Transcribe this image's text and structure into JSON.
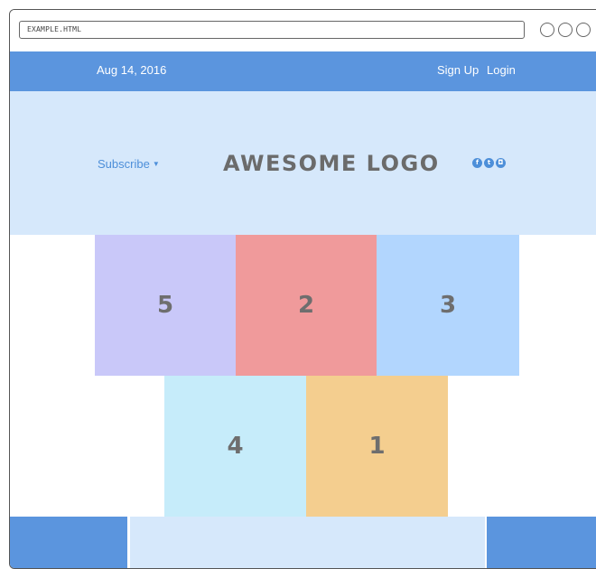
{
  "browser": {
    "url": "EXAMPLE.HTML"
  },
  "topbar": {
    "date": "Aug 14, 2016",
    "signup": "Sign Up",
    "login": "Login"
  },
  "header": {
    "subscribe": "Subscribe",
    "logo": "AWESOME LOGO",
    "social_icons": [
      "facebook-icon",
      "twitter-icon",
      "instagram-icon"
    ]
  },
  "tiles": {
    "row1": [
      "5",
      "2",
      "3"
    ],
    "row2": [
      "4",
      "1"
    ]
  },
  "colors": {
    "accent": "#5b95de",
    "header_bg": "#d6e8fb",
    "tile_lavender": "#c9c8f9",
    "tile_red": "#f09a9b",
    "tile_blue": "#b2d6fe",
    "tile_cyan": "#c6ecfa",
    "tile_orange": "#f4ce8f"
  }
}
